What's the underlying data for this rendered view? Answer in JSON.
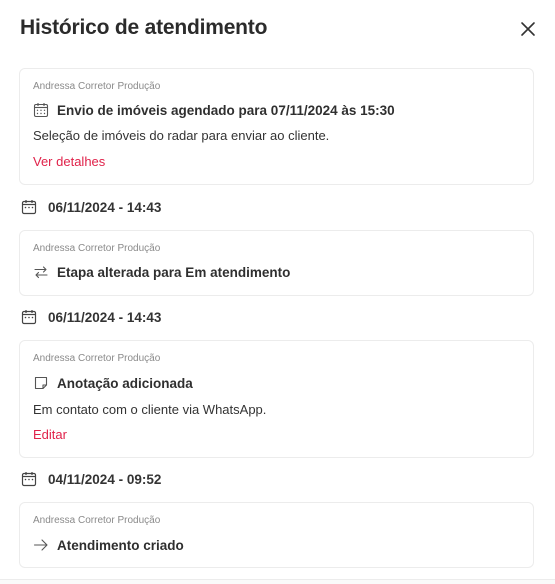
{
  "header": {
    "title": "Histórico de atendimento",
    "close_icon": "close-icon"
  },
  "timeline": [
    {
      "author": "Andressa Corretor Produção",
      "icon": "calendar-icon",
      "title": "Envio de imóveis agendado para 07/11/2024 às 15:30",
      "description": "Seleção de imóveis do radar para enviar ao cliente.",
      "action": "Ver detalhes"
    },
    {
      "date": "06/11/2024 - 14:43",
      "author": "Andressa Corretor Produção",
      "icon": "swap-arrows-icon",
      "title": "Etapa alterada para Em atendimento"
    },
    {
      "date": "06/11/2024 - 14:43",
      "author": "Andressa Corretor Produção",
      "icon": "note-icon",
      "title": "Anotação adicionada",
      "description": "Em contato com o cliente via WhatsApp.",
      "action": "Editar"
    },
    {
      "date": "04/11/2024 - 09:52",
      "author": "Andressa Corretor Produção",
      "icon": "arrow-right-icon",
      "title": "Atendimento criado"
    }
  ],
  "colors": {
    "accent": "#e0224a",
    "border": "#ececec",
    "muted_text": "#8a8a8a"
  }
}
